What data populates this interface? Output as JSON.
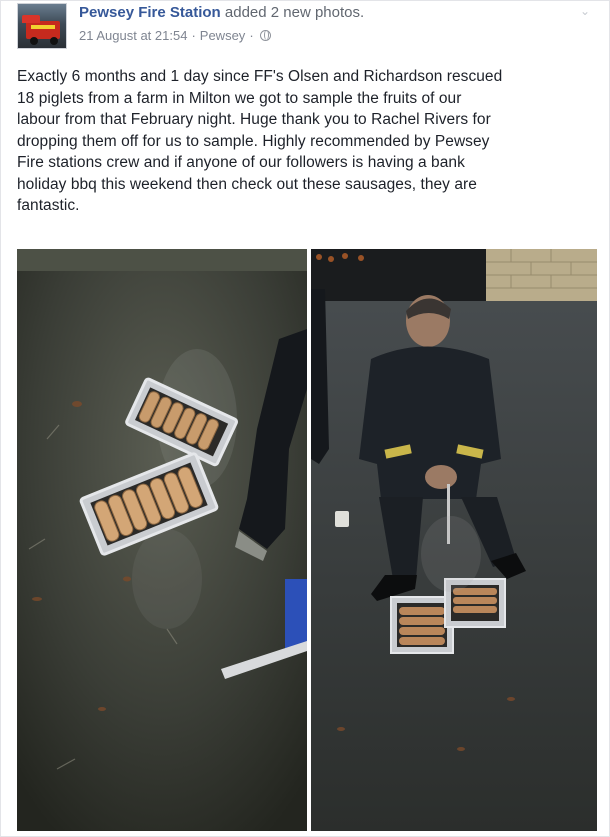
{
  "post": {
    "author": "Pewsey Fire Station",
    "action": "added 2 new photos.",
    "timestamp": "21 August at 21:54",
    "separator": " · ",
    "location": "Pewsey",
    "privacy_icon": "globe-icon",
    "options_icon": "chevron-down-icon",
    "avatar_icon": "fire-engine-avatar",
    "text_lines": [
      "Exactly 6 months and 1 day since FF's Olsen and Richardson rescued",
      "18 piglets from a farm in Milton we got to sample the fruits of our",
      "labour from that February night. Huge thank you to Rachel Rivers for",
      "dropping them off for us to sample. Highly recommended by Pewsey",
      "Fire stations crew and if anyone of our followers is having a bank",
      "holiday bbq this weekend then check out these sausages, they are",
      "fantastic."
    ]
  },
  "colors": {
    "author_link": "#365899",
    "meta_text": "#7f8591",
    "body_text": "#1d2129"
  }
}
